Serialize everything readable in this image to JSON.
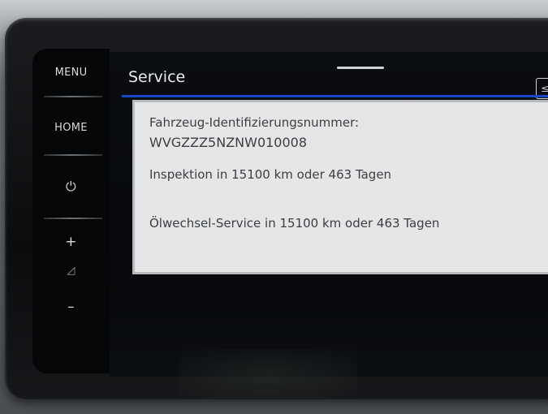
{
  "side_panel": {
    "menu_label": "MENU",
    "home_label": "HOME",
    "power_icon": "⏻",
    "volume_up": "+",
    "volume_icon": "◿",
    "volume_down": "–"
  },
  "header": {
    "title": "Service",
    "corner_icon": "≤"
  },
  "service_info": {
    "vin_label": "Fahrzeug-Identifizierungsnummer:",
    "vin_value": "WVGZZZ5NZNW010008",
    "inspection": "Inspektion in 15100 km oder 463 Tagen",
    "oil_service": "Ölwechsel-Service in 15100 km oder 463 Tagen"
  },
  "colors": {
    "accent_line": "#1a49c8",
    "card_background": "#e4e6e8",
    "screen_background": "#07090c"
  }
}
